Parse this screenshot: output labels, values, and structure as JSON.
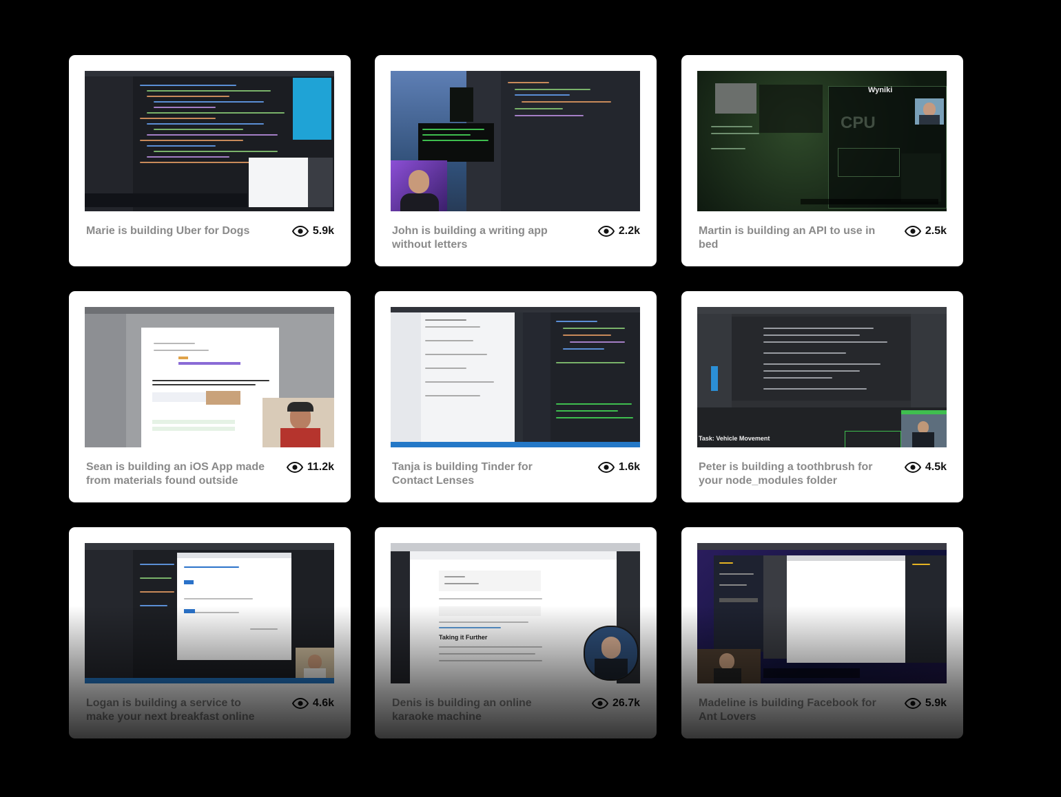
{
  "cards": [
    {
      "title": "Marie is building Uber for Dogs",
      "views": "5.9k"
    },
    {
      "title": "John is building a writing app without letters",
      "views": "2.2k"
    },
    {
      "title": "Martin is building an API to use in bed",
      "views": "2.5k"
    },
    {
      "title": "Sean is building an iOS App made from materials found outside",
      "views": "11.2k"
    },
    {
      "title": "Tanja is building Tinder for Contact Lenses",
      "views": "1.6k"
    },
    {
      "title": "Peter is building a toothbrush for your node_modules folder",
      "views": "4.5k"
    },
    {
      "title": "Logan is building a service to make your next breakfast online",
      "views": "4.6k"
    },
    {
      "title": "Denis is building an online karaoke machine",
      "views": "26.7k"
    },
    {
      "title": "Madeline is building Facebook for Ant Lovers",
      "views": "5.9k"
    }
  ],
  "thumbnails": {
    "martin": {
      "heading": "Wyniki",
      "label": "CPU"
    },
    "peter": {
      "caption": "Task: Vehicle Movement"
    },
    "denis": {
      "heading": "Taking it Further"
    }
  },
  "icons": {
    "views": "eye-icon"
  },
  "colors": {
    "background": "#000000",
    "card": "#ffffff",
    "title": "#8a8a8a",
    "views": "#111111"
  }
}
